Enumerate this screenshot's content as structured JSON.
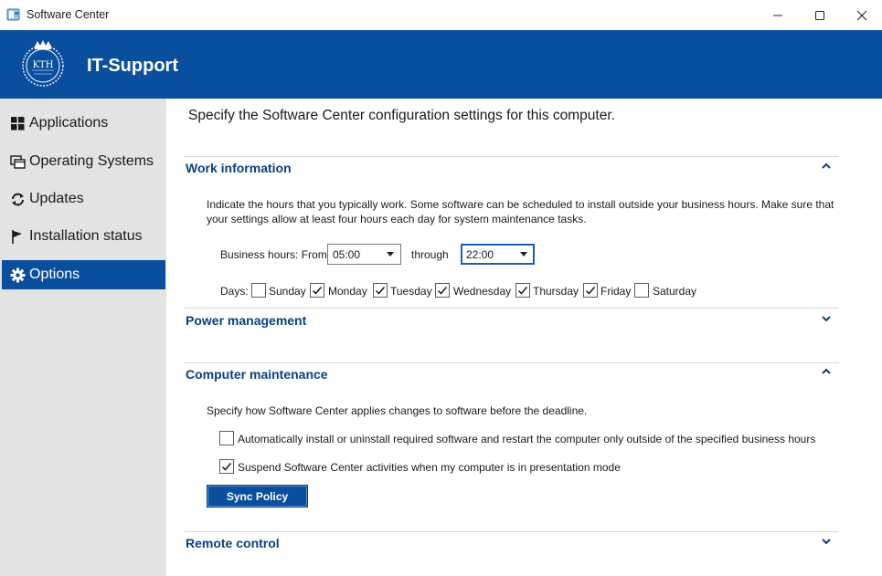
{
  "window": {
    "title": "Software Center",
    "icon": "software-center-icon",
    "controls": [
      "minimize-icon",
      "maximize-icon",
      "close-icon"
    ]
  },
  "header": {
    "brand": "IT-Support",
    "logo": "kth-seal-logo",
    "color": "#0a4f9e"
  },
  "sidebar": {
    "items": [
      {
        "label": "Applications",
        "icon": "grid-icon",
        "active": false
      },
      {
        "label": "Operating Systems",
        "icon": "windows-stack-icon",
        "active": false
      },
      {
        "label": "Updates",
        "icon": "refresh-icon",
        "active": false
      },
      {
        "label": "Installation status",
        "icon": "flag-icon",
        "active": false
      },
      {
        "label": "Options",
        "icon": "gear-icon",
        "active": true
      }
    ]
  },
  "main": {
    "title": "Specify the Software Center configuration settings for this computer.",
    "work": {
      "title": "Work information",
      "expanded": true,
      "description": "Indicate the hours that you typically work. Some software can be scheduled to install outside your business hours. Make sure that your settings allow at least four hours each day for system maintenance tasks.",
      "business_hours_label": "Business hours: From",
      "from_value": "05:00",
      "through_label": "through",
      "through_value": "22:00",
      "days_label": "Days:",
      "days": [
        {
          "label": "Sunday",
          "checked": false
        },
        {
          "label": "Monday",
          "checked": true
        },
        {
          "label": "Tuesday",
          "checked": true
        },
        {
          "label": "Wednesday",
          "checked": true
        },
        {
          "label": "Thursday",
          "checked": true
        },
        {
          "label": "Friday",
          "checked": true
        },
        {
          "label": "Saturday",
          "checked": false
        }
      ]
    },
    "power": {
      "title": "Power management",
      "expanded": false
    },
    "maintenance": {
      "title": "Computer maintenance",
      "expanded": true,
      "description": "Specify how Software Center applies changes to software before the deadline.",
      "options": [
        {
          "label": "Automatically install or uninstall required software and restart the computer only outside of the specified business hours",
          "checked": false
        },
        {
          "label": "Suspend Software Center activities when my computer is in presentation mode",
          "checked": true
        }
      ],
      "sync_button": "Sync Policy"
    },
    "remote": {
      "title": "Remote control",
      "expanded": false
    }
  }
}
